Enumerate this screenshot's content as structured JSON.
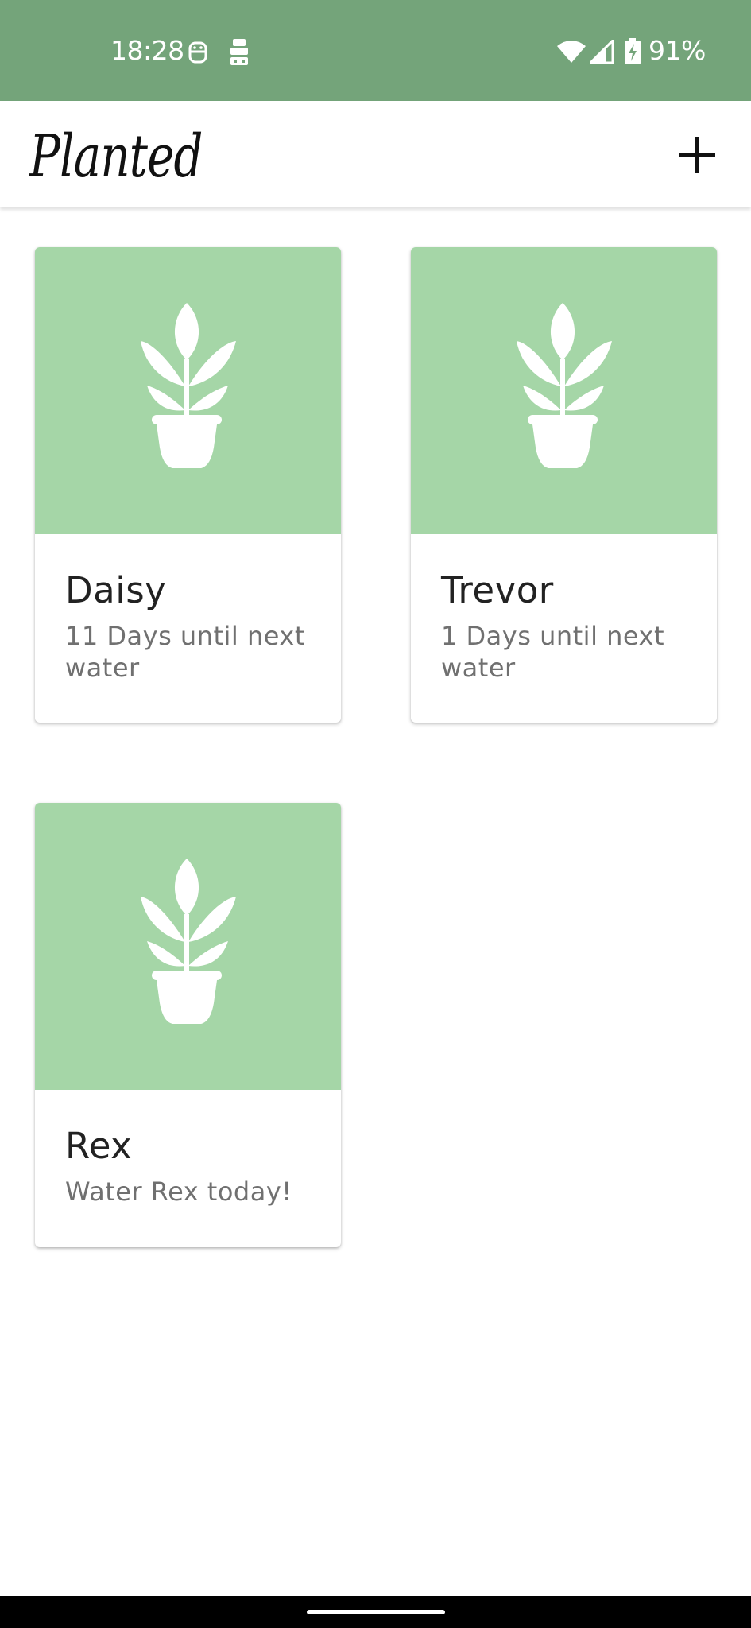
{
  "status_bar": {
    "time": "18:28",
    "battery_percent": "91%",
    "background_color": "#74a47a",
    "icons": [
      "notification-robot-icon",
      "notification-stack-icon",
      "wifi-icon",
      "signal-icon",
      "battery-charging-icon"
    ]
  },
  "app_bar": {
    "title": "Planted",
    "add_icon": "plus-icon"
  },
  "plants": [
    {
      "name": "Daisy",
      "status": "11 Days until next water",
      "image_icon": "potted-plant-icon"
    },
    {
      "name": "Trevor",
      "status": "1 Days until next water",
      "image_icon": "potted-plant-icon"
    },
    {
      "name": "Rex",
      "status": "Water Rex today!",
      "image_icon": "potted-plant-icon"
    }
  ],
  "colors": {
    "card_image_background": "#a5d6a7",
    "accent": "#74a47a"
  }
}
